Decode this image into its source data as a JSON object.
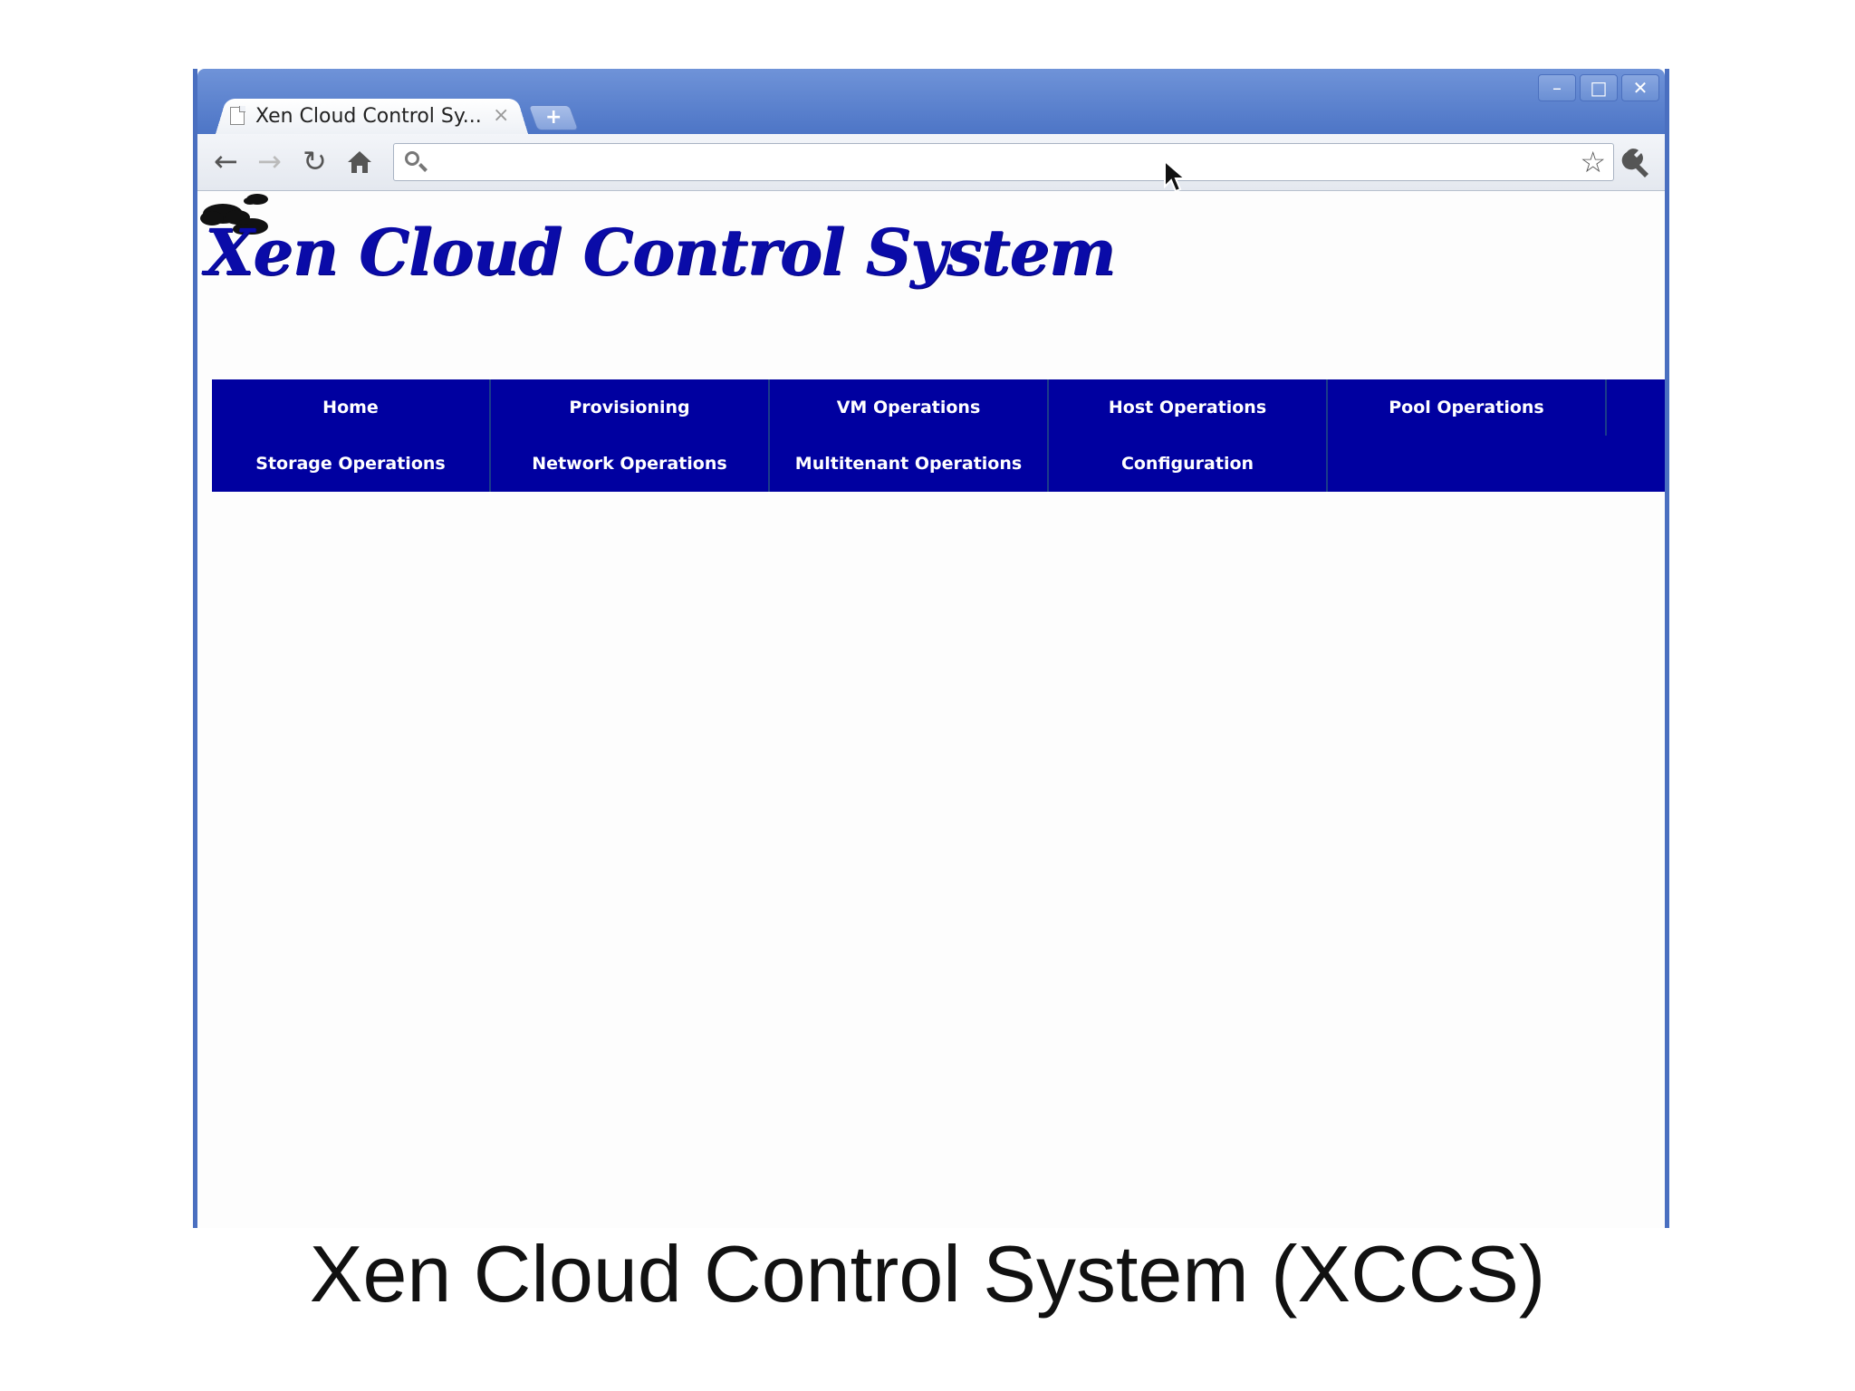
{
  "browser": {
    "tab_title": "Xen Cloud Control Sy...",
    "tab_close": "×",
    "new_tab": "+",
    "window_buttons": {
      "minimize": "–",
      "maximize": "□",
      "close": "✕"
    },
    "omnibox": {
      "value": "",
      "placeholder": ""
    }
  },
  "site": {
    "logo_text": "Xen Cloud Control System",
    "menu": {
      "row1": [
        "Home",
        "Provisioning",
        "VM Operations",
        "Host Operations",
        "Pool Operations"
      ],
      "row2": [
        "Storage Operations",
        "Network Operations",
        "Multitenant Operations",
        "Configuration"
      ]
    }
  },
  "caption": "Xen Cloud Control System (XCCS)",
  "colors": {
    "menu_bg": "#0000a0",
    "logo_text": "#0a0ba8",
    "titlebar": "#5a80cc",
    "window_border": "#4a6fc0"
  }
}
